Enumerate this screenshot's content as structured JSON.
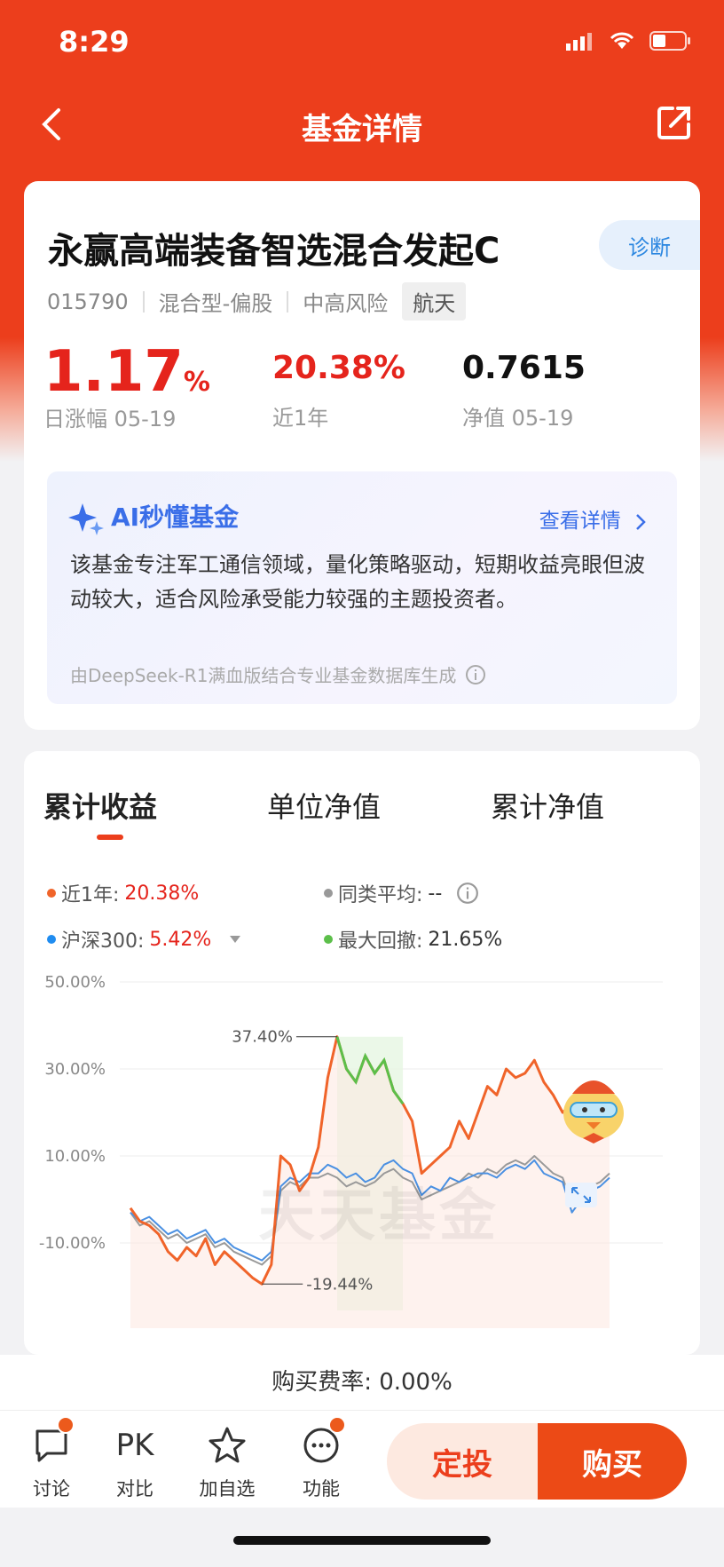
{
  "status": {
    "time": "8:29"
  },
  "nav": {
    "title": "基金详情"
  },
  "fund": {
    "name": "永赢高端装备智选混合发起C",
    "diagnose": "诊断",
    "code": "015790",
    "type": "混合型-偏股",
    "risk": "中高风险",
    "theme": "航天",
    "daily_value": "1.17",
    "daily_unit": "%",
    "daily_label": "日涨幅 05-19",
    "year_value": "20.38%",
    "year_label": "近1年",
    "nav_value": "0.7615",
    "nav_label": "净值 05-19"
  },
  "ai": {
    "title": "AI秒懂基金",
    "link": "查看详情",
    "body": "该基金专注军工通信领域，量化策略驱动，短期收益亮眼但波动较大，适合风险承受能力较强的主题投资者。",
    "footer": "由DeepSeek-R1满血版结合专业基金数据库生成"
  },
  "tabs": [
    "累计收益",
    "单位净值",
    "累计净值"
  ],
  "legend": {
    "year_label": "近1年: ",
    "year_value": "20.38%",
    "avg_label": "同类平均: ",
    "avg_value": "--",
    "hs_label": "沪深300: ",
    "hs_value": "5.42%",
    "dd_label": "最大回撤: ",
    "dd_value": "21.65%"
  },
  "watermark": "天天基金",
  "fee": "购买费率: 0.00%",
  "toolbar": {
    "discuss": "讨论",
    "pk_glyph": "PK",
    "compare": "对比",
    "watch": "加自选",
    "func": "功能",
    "dingtou": "定投",
    "buy": "购买"
  },
  "colors": {
    "accent": "#ec3e1c",
    "fund": "#f0642a",
    "hs300": "#4a90e2",
    "avg": "#999999",
    "drawdown": "#5cbf4a"
  },
  "chart_data": {
    "type": "line",
    "yticks": [
      "50.00%",
      "30.00%",
      "10.00%",
      "-10.00%"
    ],
    "ylim": [
      -10,
      50
    ],
    "annotations": [
      "37.40%",
      "-19.44%"
    ],
    "series": [
      {
        "name": "近1年",
        "values": [
          -2,
          -5,
          -6,
          -8,
          -12,
          -14,
          -11,
          -13,
          -9,
          -15,
          -12,
          -14,
          -16,
          -18,
          -19.44,
          -15,
          10,
          8,
          2,
          5,
          12,
          28,
          37.4,
          30,
          27,
          33,
          29,
          32,
          25,
          22,
          18,
          6,
          8,
          10,
          12,
          18,
          14,
          20,
          26,
          24,
          30,
          28,
          29,
          32,
          27,
          24,
          20,
          22,
          16,
          18,
          23,
          20
        ]
      },
      {
        "name": "沪深300",
        "values": [
          -3,
          -5,
          -4,
          -6,
          -8,
          -7,
          -9,
          -8,
          -7,
          -10,
          -9,
          -11,
          -12,
          -13,
          -14,
          -12,
          3,
          5,
          4,
          6,
          6,
          8,
          7,
          5,
          6,
          4,
          5,
          8,
          9,
          7,
          6,
          1,
          3,
          2,
          5,
          4,
          5,
          6,
          6,
          5,
          7,
          8,
          7,
          9,
          6,
          5,
          4,
          -3,
          0,
          2,
          3,
          5
        ]
      },
      {
        "name": "同类平均",
        "values": [
          -3,
          -6,
          -5,
          -7,
          -9,
          -8,
          -10,
          -9,
          -8,
          -11,
          -10,
          -12,
          -13,
          -14,
          -15,
          -13,
          2,
          4,
          3,
          5,
          5,
          6,
          5,
          3,
          4,
          3,
          4,
          6,
          7,
          5,
          4,
          0,
          1,
          2,
          3,
          4,
          6,
          5,
          7,
          6,
          8,
          9,
          8,
          10,
          8,
          6,
          5,
          -1,
          1,
          3,
          4,
          6
        ]
      }
    ]
  }
}
